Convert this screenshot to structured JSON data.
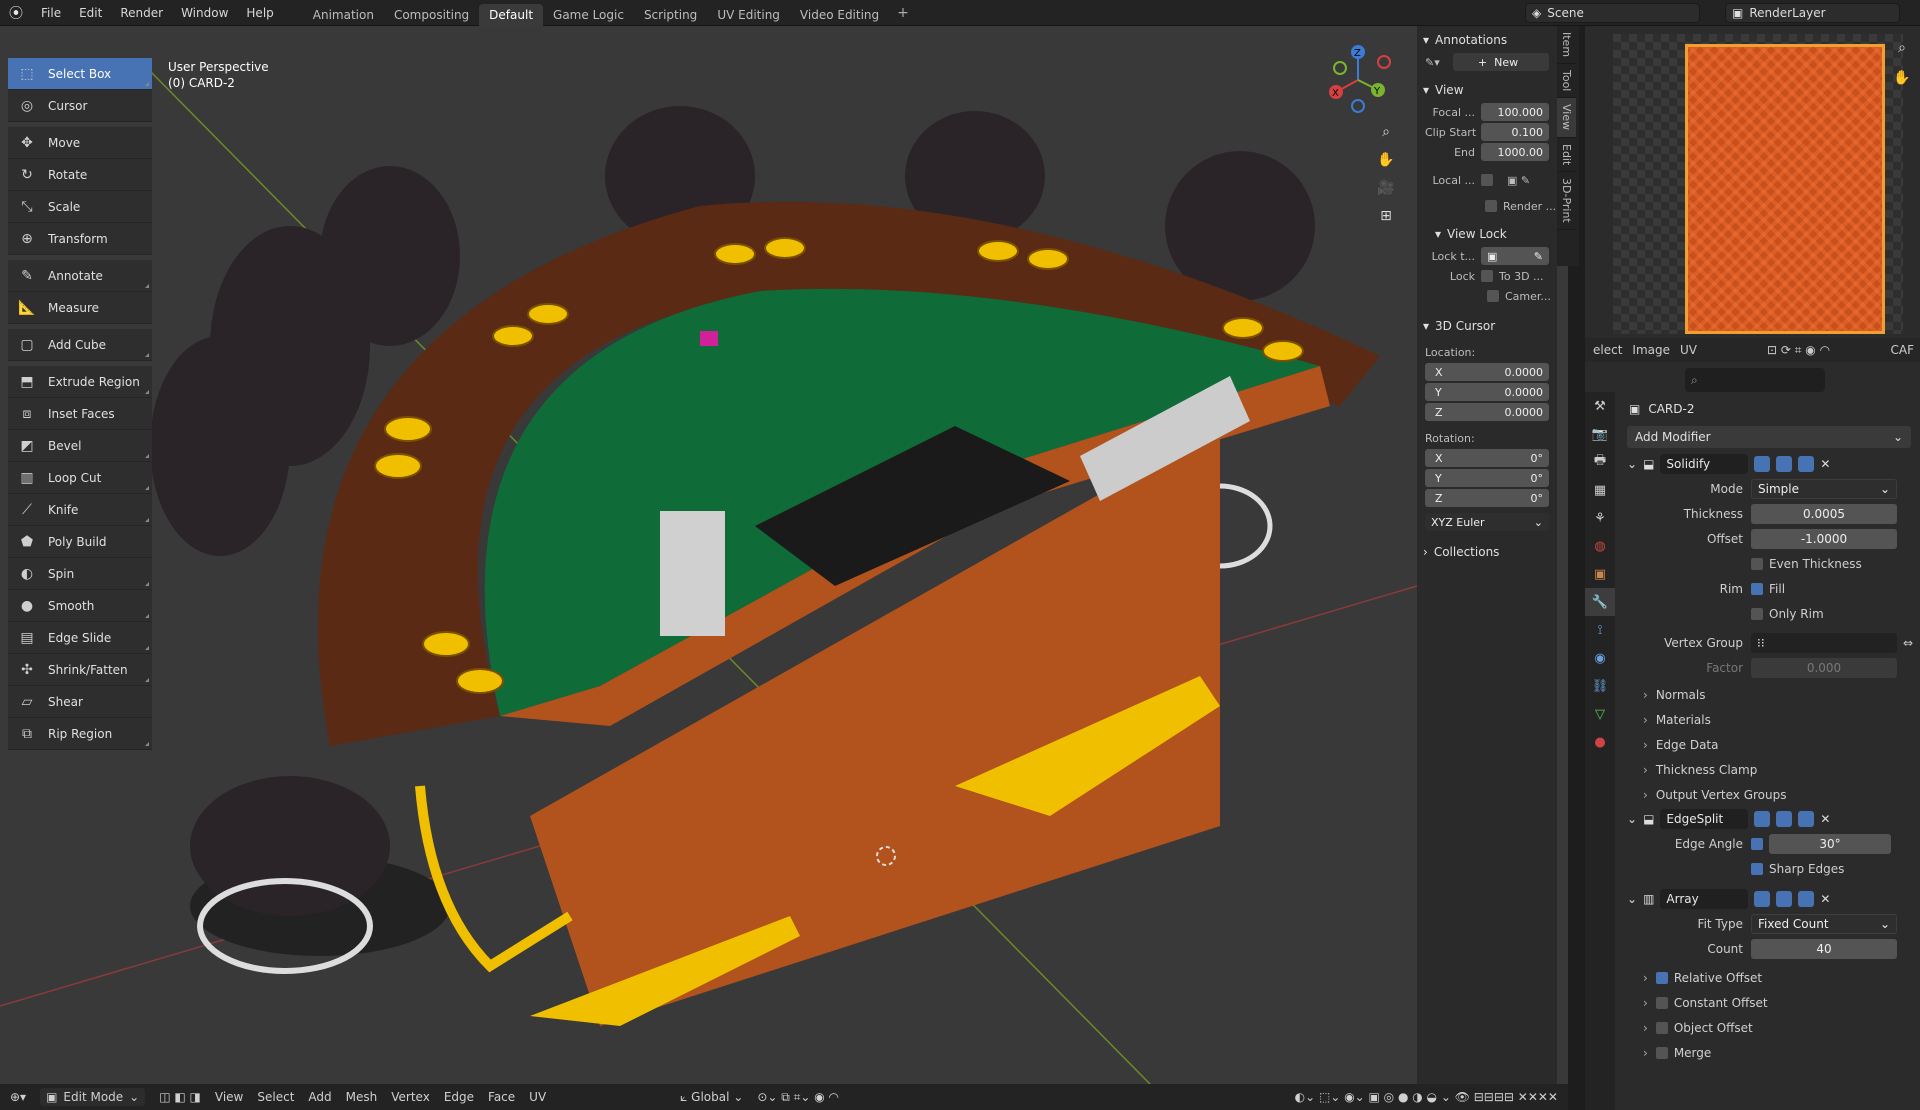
{
  "menu": [
    "File",
    "Edit",
    "Render",
    "Window",
    "Help"
  ],
  "workspaces": [
    "Animation",
    "Compositing",
    "Default",
    "Game Logic",
    "Scripting",
    "UV Editing",
    "Video Editing"
  ],
  "active_workspace": "Default",
  "scene": {
    "name": "Scene",
    "render_layer": "RenderLayer"
  },
  "viewport": {
    "title": "User Perspective",
    "subtitle": "(0) CARD-2"
  },
  "tools": [
    "Select Box",
    "Cursor",
    "Move",
    "Rotate",
    "Scale",
    "Transform",
    "Annotate",
    "Measure",
    "Add Cube",
    "Extrude Region",
    "Inset Faces",
    "Bevel",
    "Loop Cut",
    "Knife",
    "Poly Build",
    "Spin",
    "Smooth",
    "Edge Slide",
    "Shrink/Fatten",
    "Shear",
    "Rip Region"
  ],
  "active_tool": "Select Box",
  "npanel": {
    "annotations": "Annotations",
    "new_btn": "New",
    "view": "View",
    "focal_label": "Focal ...",
    "focal": "100.000",
    "clip_start_label": "Clip Start",
    "clip_start": "0.100",
    "end_label": "End",
    "end": "1000.00",
    "local_label": "Local ...",
    "render_label": "Render ...",
    "view_lock": "View Lock",
    "lock_to_label": "Lock t...",
    "lock_label": "Lock",
    "to3d": "To 3D ...",
    "camera": "Camer...",
    "cursor": "3D Cursor",
    "location": "Location:",
    "loc_x": "0.0000",
    "loc_y": "0.0000",
    "loc_z": "0.0000",
    "rotation": "Rotation:",
    "rot_x": "0°",
    "rot_y": "0°",
    "rot_z": "0°",
    "euler": "XYZ Euler",
    "collections": "Collections",
    "x": "X",
    "y": "Y",
    "z": "Z"
  },
  "vtabs": [
    "Item",
    "Tool",
    "View",
    "Edit",
    "3D-Print"
  ],
  "image_editor": {
    "menus": [
      "elect",
      "Image",
      "UV"
    ],
    "extra": "CAF"
  },
  "properties": {
    "object": "CARD-2",
    "add_modifier": "Add Modifier",
    "solidify": {
      "name": "Solidify",
      "mode_label": "Mode",
      "mode": "Simple",
      "thickness_label": "Thickness",
      "thickness": "0.0005",
      "offset_label": "Offset",
      "offset": "-1.0000",
      "even_thickness": "Even Thickness",
      "rim_label": "Rim",
      "fill": "Fill",
      "only_rim": "Only Rim",
      "vgroup_label": "Vertex Group",
      "factor_label": "Factor",
      "factor": "0.000"
    },
    "subpanels1": [
      "Normals",
      "Materials",
      "Edge Data",
      "Thickness Clamp",
      "Output Vertex Groups"
    ],
    "edgesplit": {
      "name": "EdgeSplit",
      "edge_angle_label": "Edge Angle",
      "edge_angle": "30°",
      "sharp_edges": "Sharp Edges"
    },
    "array": {
      "name": "Array",
      "fit_type_label": "Fit Type",
      "fit_type": "Fixed Count",
      "count_label": "Count",
      "count": "40"
    },
    "subpanels2": [
      "Relative Offset",
      "Constant Offset",
      "Object Offset",
      "Merge"
    ]
  },
  "statusbar": {
    "mode": "Edit Mode",
    "menus": [
      "View",
      "Select",
      "Add",
      "Mesh",
      "Vertex",
      "Edge",
      "Face",
      "UV"
    ],
    "orientation": "Global"
  },
  "colors": {
    "accent": "#4772b3",
    "felt": "#0f6b38",
    "wood": "#b2521c",
    "rail": "#5a2a14",
    "gold": "#f0c000"
  }
}
